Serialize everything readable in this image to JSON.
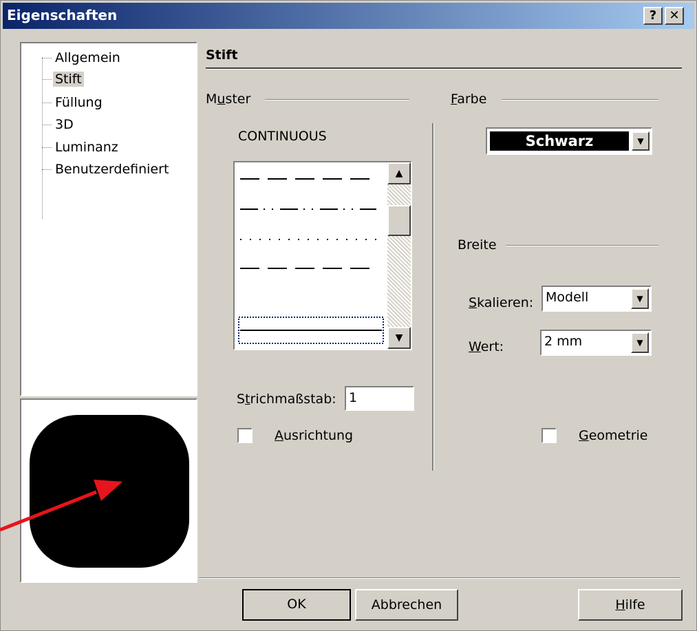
{
  "window": {
    "title": "Eigenschaften",
    "help_glyph": "?",
    "close_glyph": "✕"
  },
  "tree": {
    "items": [
      {
        "label": "Allgemein"
      },
      {
        "label": "Stift"
      },
      {
        "label": "Füllung"
      },
      {
        "label": "3D"
      },
      {
        "label": "Luminanz"
      },
      {
        "label": "Benutzerdefiniert"
      }
    ],
    "selected": "Stift"
  },
  "section": {
    "title": "Stift"
  },
  "muster": {
    "label_pre": "M",
    "label_u": "u",
    "label_post": "ster",
    "current": "CONTINUOUS",
    "patterns": [
      "dashed-long",
      "dash-dot-dot",
      "dotted",
      "dashed",
      "blank",
      "continuous"
    ]
  },
  "strichmassstab": {
    "label_pre": "S",
    "label_u": "t",
    "label_post": "richmaßstab:",
    "value": "1"
  },
  "ausrichtung": {
    "label_u": "A",
    "label_post": "usrichtung",
    "checked": false
  },
  "farbe": {
    "label_u": "F",
    "label_post": "arbe",
    "value": "Schwarz"
  },
  "breite": {
    "label": "Breite"
  },
  "skalieren": {
    "label_u": "S",
    "label_post": "kalieren:",
    "value": "Modell"
  },
  "wert": {
    "label_u": "W",
    "label_post": "ert:",
    "value": "2 mm"
  },
  "geometrie": {
    "label_u": "G",
    "label_post": "eometrie",
    "checked": false
  },
  "buttons": {
    "ok": "OK",
    "cancel": "Abbrechen",
    "help_u": "H",
    "help_post": "ilfe"
  },
  "colors": {
    "titlebar_start": "#0a246a",
    "titlebar_end": "#a6caf0",
    "face": "#d4d0c8",
    "annotation_arrow": "#e8141b"
  }
}
